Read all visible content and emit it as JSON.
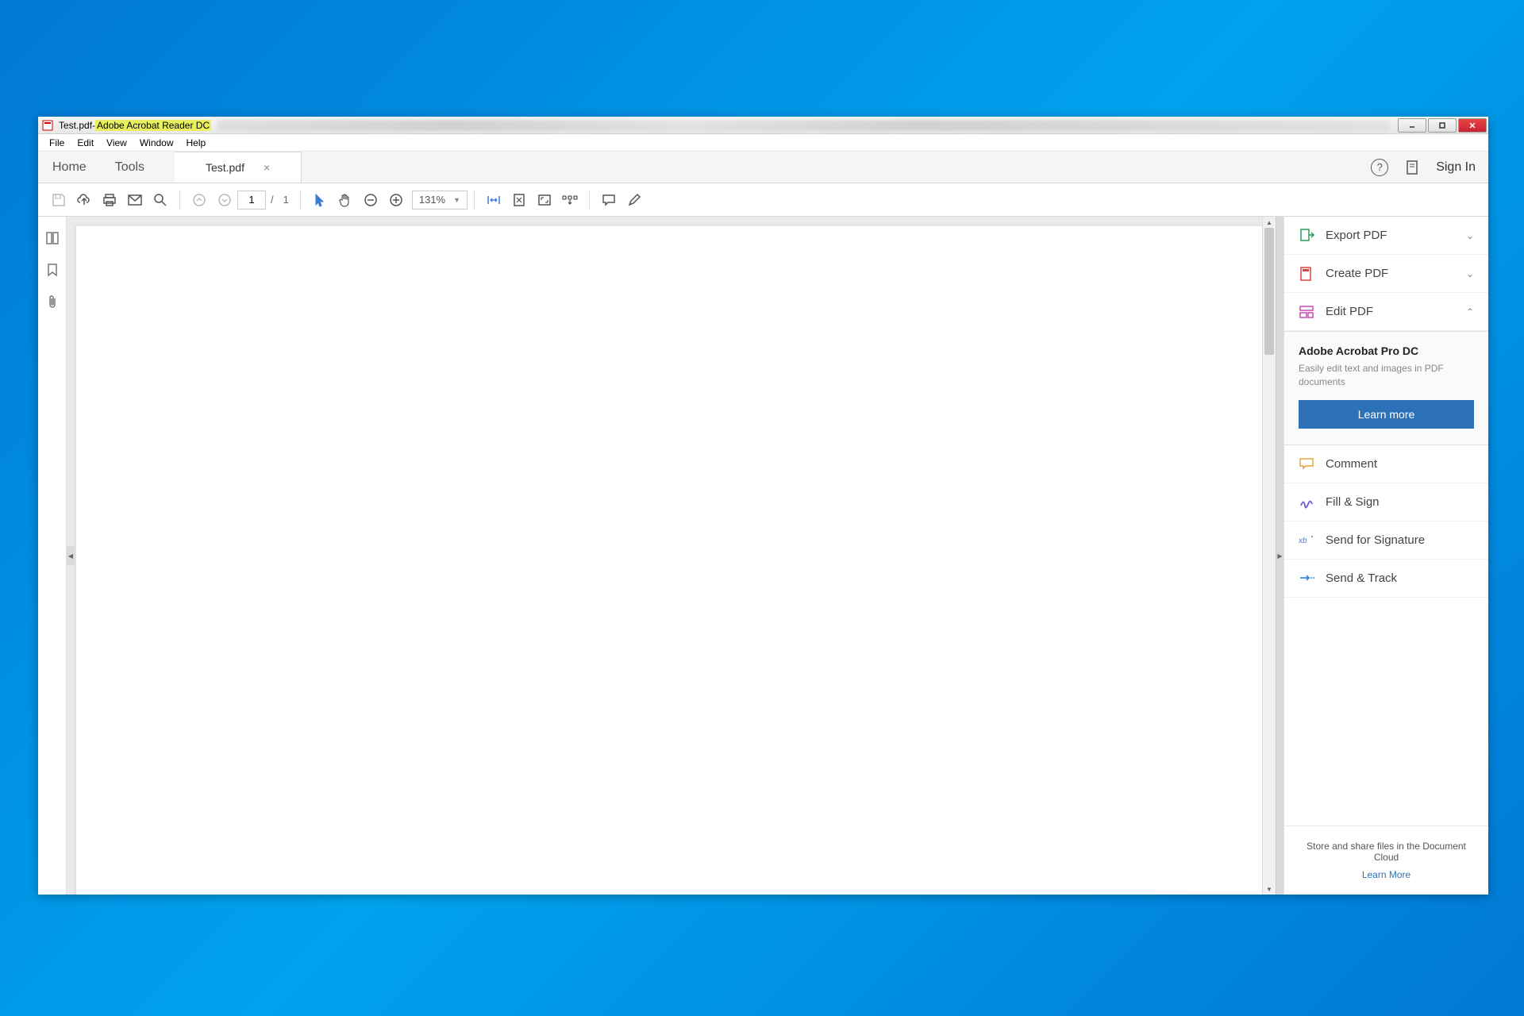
{
  "window": {
    "doc_name": "Test.pdf",
    "separator": " - ",
    "app_name": "Adobe Acrobat Reader DC"
  },
  "menu": [
    "File",
    "Edit",
    "View",
    "Window",
    "Help"
  ],
  "tabs": {
    "home": "Home",
    "tools": "Tools",
    "doc": "Test.pdf",
    "signin": "Sign In"
  },
  "toolbar": {
    "page_current": "1",
    "page_prefix": "/",
    "page_total": "1",
    "zoom": "131%"
  },
  "right_panel": {
    "export": "Export PDF",
    "create": "Create PDF",
    "edit": "Edit PDF",
    "promo": {
      "title": "Adobe Acrobat Pro DC",
      "desc": "Easily edit text and images in PDF documents",
      "button": "Learn more"
    },
    "comment": "Comment",
    "fill_sign": "Fill & Sign",
    "send_sig": "Send for Signature",
    "send_track": "Send & Track",
    "footer_text": "Store and share files in the Document Cloud",
    "footer_link": "Learn More"
  }
}
